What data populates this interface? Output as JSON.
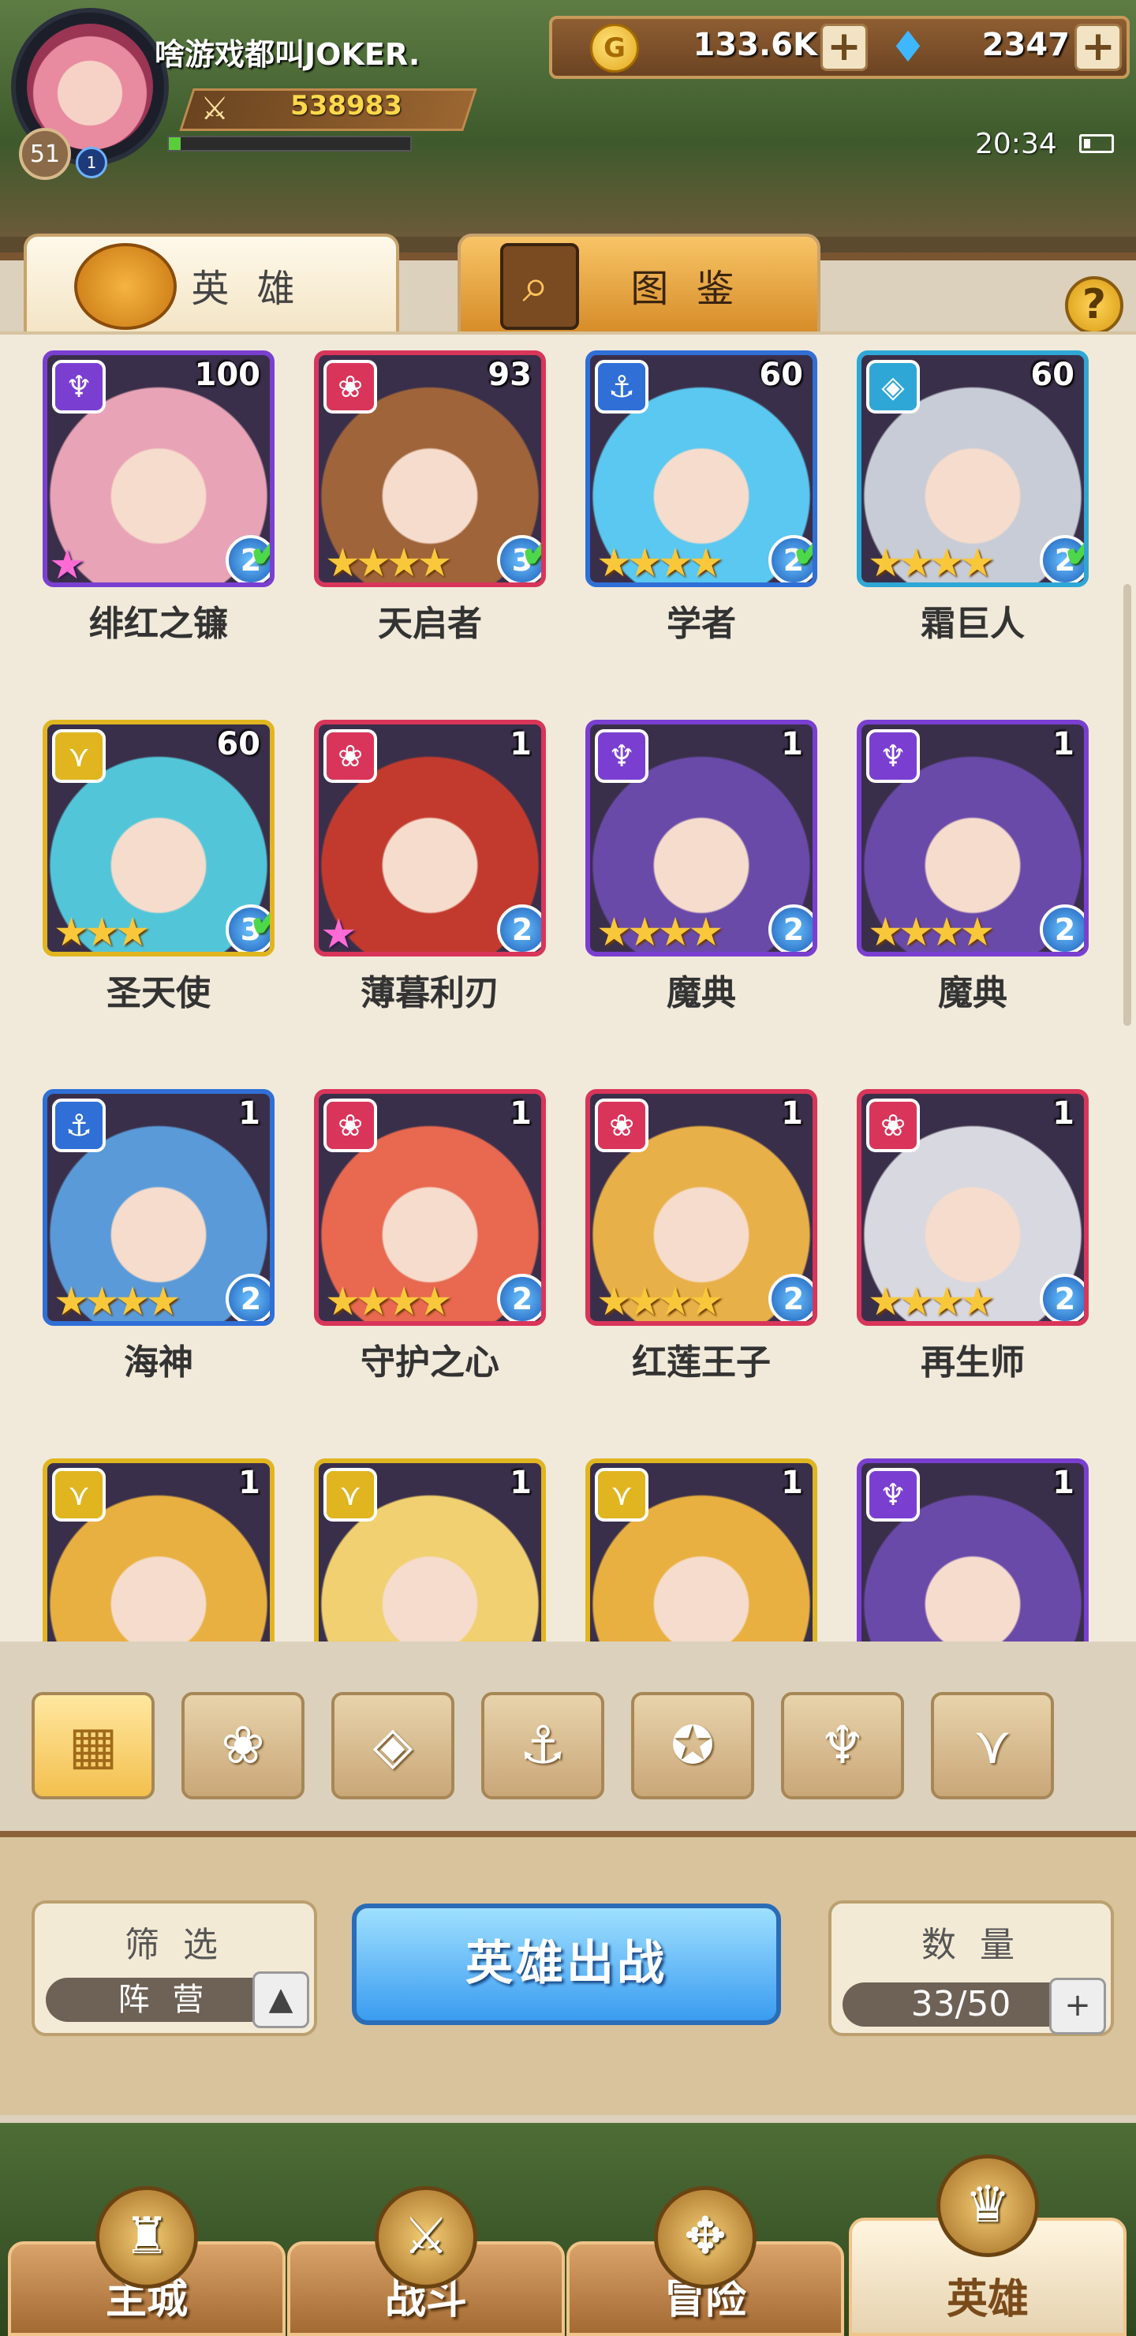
{
  "player": {
    "name": "啥游戏都叫JOKER.",
    "level": "51",
    "power": "538983",
    "vip": "1",
    "exp_fraction": 0.05
  },
  "resources": {
    "gold": "133.6K",
    "gems": "2347"
  },
  "clock": "20:34",
  "tabs": {
    "heroes": "英 雄",
    "codex": "图 鉴"
  },
  "help": "?",
  "heroes": [
    {
      "name": "绯红之镰",
      "level": "100",
      "faction": "purple",
      "faction_icon": "horn-icon",
      "stars": 0,
      "rainbow": true,
      "grade": "2",
      "check": true
    },
    {
      "name": "天启者",
      "level": "93",
      "faction": "pink",
      "faction_icon": "lotus-icon",
      "stars": 4,
      "rainbow": false,
      "grade": "3",
      "check": true
    },
    {
      "name": "学者",
      "level": "60",
      "faction": "blue",
      "faction_icon": "anchor-icon",
      "stars": 4,
      "rainbow": false,
      "grade": "2",
      "check": true
    },
    {
      "name": "霜巨人",
      "level": "60",
      "faction": "cyan",
      "faction_icon": "diamond-icon",
      "stars": 4,
      "rainbow": false,
      "grade": "2",
      "check": true
    },
    {
      "name": "圣天使",
      "level": "60",
      "faction": "gold",
      "faction_icon": "wing-icon",
      "stars": 3,
      "rainbow": false,
      "grade": "3",
      "check": true
    },
    {
      "name": "薄暮利刃",
      "level": "1",
      "faction": "pink",
      "faction_icon": "lotus-icon",
      "stars": 0,
      "rainbow": true,
      "grade": "2",
      "check": false
    },
    {
      "name": "魔典",
      "level": "1",
      "faction": "purple",
      "faction_icon": "horn-icon",
      "stars": 4,
      "rainbow": false,
      "grade": "2",
      "check": false
    },
    {
      "name": "魔典",
      "level": "1",
      "faction": "purple",
      "faction_icon": "horn-icon",
      "stars": 4,
      "rainbow": false,
      "grade": "2",
      "check": false
    },
    {
      "name": "海神",
      "level": "1",
      "faction": "blue",
      "faction_icon": "anchor-icon",
      "stars": 4,
      "rainbow": false,
      "grade": "2",
      "check": false
    },
    {
      "name": "守护之心",
      "level": "1",
      "faction": "pink",
      "faction_icon": "lotus-icon",
      "stars": 4,
      "rainbow": false,
      "grade": "2",
      "check": false
    },
    {
      "name": "红莲王子",
      "level": "1",
      "faction": "pink",
      "faction_icon": "lotus-icon",
      "stars": 4,
      "rainbow": false,
      "grade": "2",
      "check": false
    },
    {
      "name": "再生师",
      "level": "1",
      "faction": "pink",
      "faction_icon": "lotus-icon",
      "stars": 4,
      "rainbow": false,
      "grade": "2",
      "check": false
    },
    {
      "name": "",
      "level": "1",
      "faction": "gold",
      "faction_icon": "wing-icon",
      "stars": 0,
      "rainbow": false,
      "grade": "",
      "check": false
    },
    {
      "name": "",
      "level": "1",
      "faction": "gold",
      "faction_icon": "wing-icon",
      "stars": 0,
      "rainbow": false,
      "grade": "",
      "check": false
    },
    {
      "name": "",
      "level": "1",
      "faction": "gold",
      "faction_icon": "wing-icon",
      "stars": 0,
      "rainbow": false,
      "grade": "",
      "check": false
    },
    {
      "name": "",
      "level": "1",
      "faction": "purple",
      "faction_icon": "horn-icon",
      "stars": 0,
      "rainbow": false,
      "grade": "",
      "check": false
    }
  ],
  "faction_colors": {
    "purple": "#7a3fd1",
    "pink": "#d9355a",
    "blue": "#2f6fd6",
    "cyan": "#2fa7d6",
    "gold": "#e0b520"
  },
  "faction_filters": [
    {
      "icon": "grid-icon",
      "active": true
    },
    {
      "icon": "lotus-icon",
      "active": false
    },
    {
      "icon": "diamond-icon",
      "active": false
    },
    {
      "icon": "anchor-icon",
      "active": false
    },
    {
      "icon": "beast-icon",
      "active": false
    },
    {
      "icon": "horn-icon",
      "active": false
    },
    {
      "icon": "wing-icon",
      "active": false
    }
  ],
  "filter_panel": {
    "title": "筛 选",
    "value": "阵 营"
  },
  "deploy_button": "英雄出战",
  "count_panel": {
    "title": "数 量",
    "value": "33/50"
  },
  "nav": [
    {
      "label": "主城",
      "icon": "castle-icon",
      "active": false
    },
    {
      "label": "战斗",
      "icon": "crossed-swords-icon",
      "active": false
    },
    {
      "label": "冒险",
      "icon": "map-icon",
      "active": false
    },
    {
      "label": "英雄",
      "icon": "hero-crest-icon",
      "active": true
    }
  ]
}
